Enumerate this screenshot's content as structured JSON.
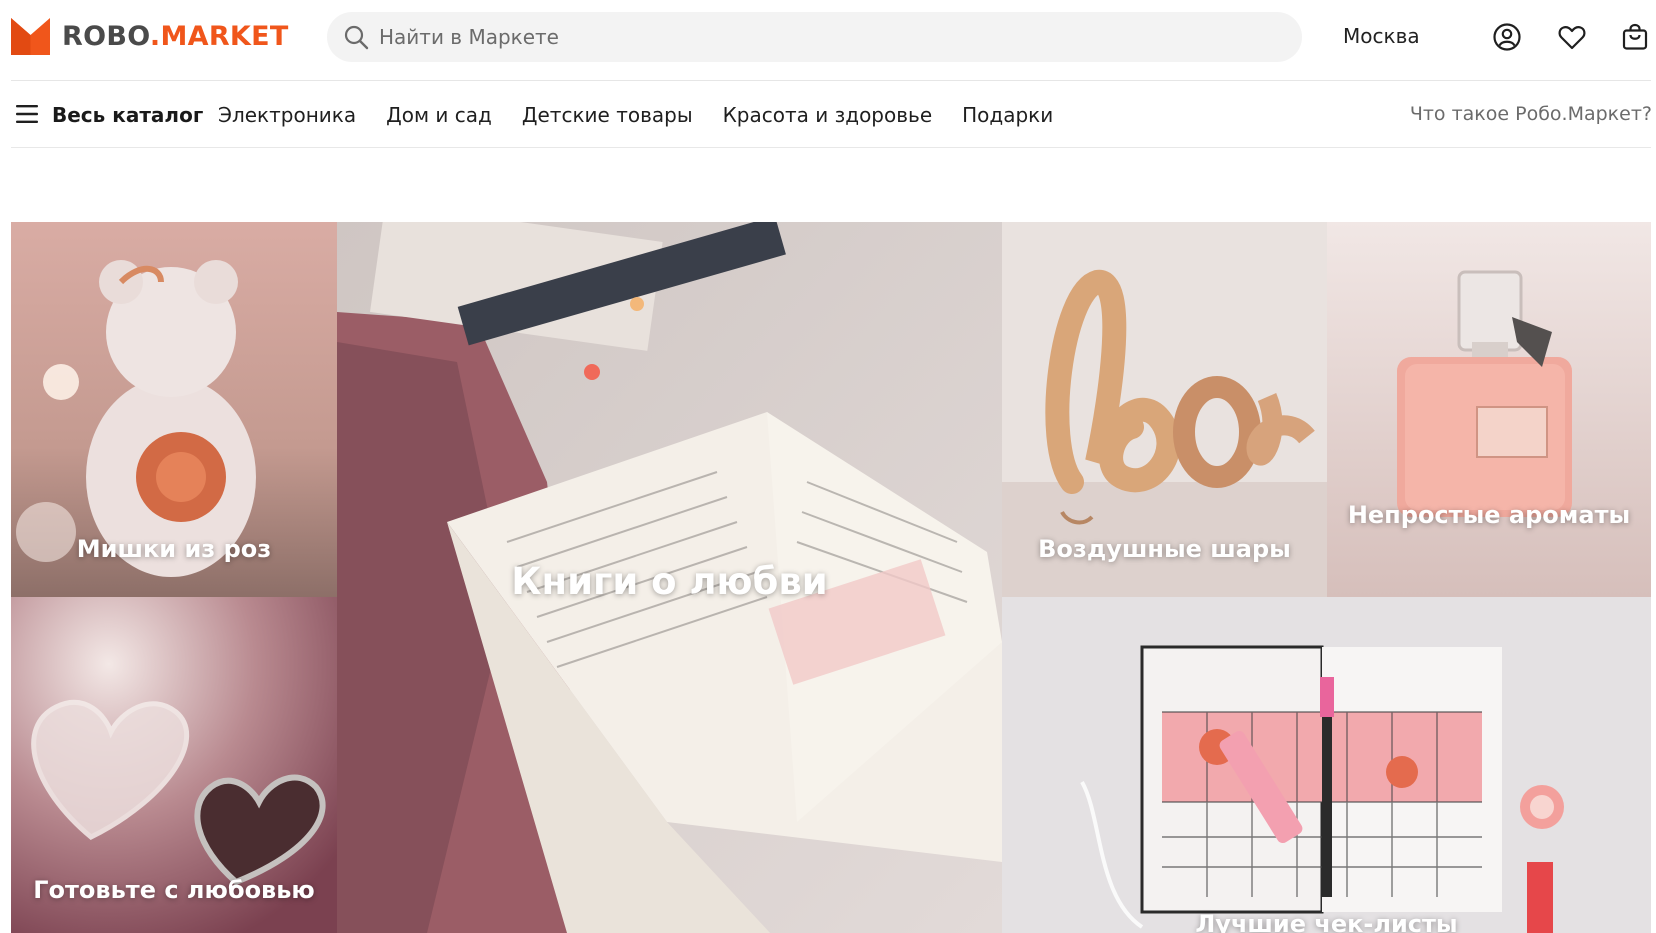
{
  "header": {
    "logo_left": "ROBO",
    "logo_dot": ".",
    "logo_right": "MARKET",
    "search_placeholder": "Найти в Маркете",
    "city": "Москва",
    "icons": [
      "user-icon",
      "heart-icon",
      "cart-icon"
    ]
  },
  "nav": {
    "catalog": "Весь каталог",
    "links": [
      "Электроника",
      "Дом и сад",
      "Детские товары",
      "Красота и здоровье",
      "Подарки"
    ],
    "about": "Что такое Робо.Маркет?"
  },
  "tiles": {
    "teddy": "Мишки из роз",
    "books": "Книги о любви",
    "balloons": "Воздушные шары",
    "perfume": "Непростые ароматы",
    "cook": "Готовьте с любовью",
    "checklists": "Лучшие чек-листы"
  },
  "colors": {
    "brand": "#f0561b",
    "logo_text": "#4a4a4a"
  }
}
